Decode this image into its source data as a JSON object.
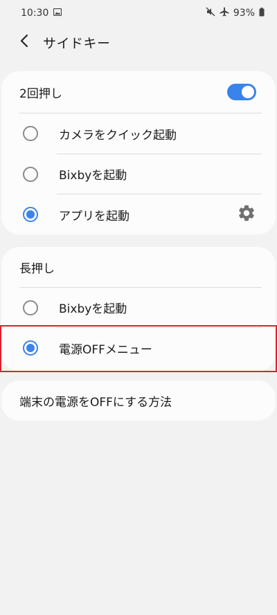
{
  "status_bar": {
    "time": "10:30",
    "battery": "93%",
    "icons": [
      "image-icon",
      "mute-icon",
      "airplane-icon",
      "battery-icon"
    ]
  },
  "app_bar": {
    "title": "サイドキー",
    "back_icon": "chevron-left-icon"
  },
  "double_press": {
    "title": "2回押し",
    "enabled": true,
    "options": [
      {
        "label": "カメラをクイック起動",
        "selected": false
      },
      {
        "label": "Bixbyを起動",
        "selected": false
      },
      {
        "label": "アプリを起動",
        "selected": true,
        "has_settings": true
      }
    ]
  },
  "long_press": {
    "title": "長押し",
    "options": [
      {
        "label": "Bixbyを起動",
        "selected": false
      },
      {
        "label": "電源OFFメニュー",
        "selected": true
      }
    ]
  },
  "power_off_link": {
    "label": "端末の電源をOFFにする方法"
  },
  "colors": {
    "accent": "#3a83ea",
    "background": "#f2f2f2",
    "card": "#fcfcfc",
    "highlight": "#d9232e"
  }
}
